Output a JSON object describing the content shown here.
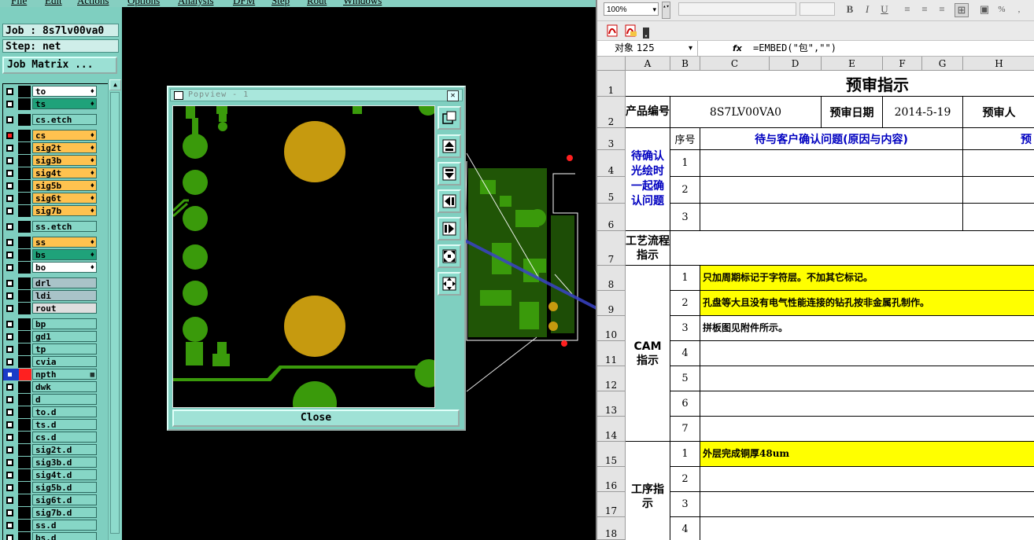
{
  "genesis": {
    "menu": [
      "File",
      "Edit",
      "Actions",
      "Options",
      "Analysis",
      "DFM",
      "Step",
      "Rout",
      "Windows"
    ],
    "job_label": "Job : 8s7lv00va0",
    "step_label": "Step: net",
    "job_matrix": "Job Matrix ...",
    "layers": [
      {
        "name": "to",
        "color": "#ffffff",
        "active": false,
        "mark": "♦"
      },
      {
        "name": "ts",
        "color": "#1fa27a",
        "active": false,
        "mark": "♦"
      },
      {
        "name": "cs.etch",
        "color": "#86d6c6",
        "active": false,
        "mark": ""
      },
      {
        "name": "cs",
        "color": "#ffc24f",
        "active": true,
        "mark": "♦"
      },
      {
        "name": "sig2t",
        "color": "#ffc24f",
        "active": false,
        "mark": "♦"
      },
      {
        "name": "sig3b",
        "color": "#ffc24f",
        "active": false,
        "mark": "♦"
      },
      {
        "name": "sig4t",
        "color": "#ffc24f",
        "active": false,
        "mark": "♦"
      },
      {
        "name": "sig5b",
        "color": "#ffc24f",
        "active": false,
        "mark": "♦"
      },
      {
        "name": "sig6t",
        "color": "#ffc24f",
        "active": false,
        "mark": "♦"
      },
      {
        "name": "sig7b",
        "color": "#ffc24f",
        "active": false,
        "mark": "♦"
      },
      {
        "name": "ss.etch",
        "color": "#86d6c6",
        "active": false,
        "mark": ""
      },
      {
        "name": "ss",
        "color": "#ffc24f",
        "active": false,
        "mark": "♦"
      },
      {
        "name": "bs",
        "color": "#1fa27a",
        "active": false,
        "mark": "♦"
      },
      {
        "name": "bo",
        "color": "#ffffff",
        "active": false,
        "mark": "♦"
      },
      {
        "name": "drl",
        "color": "#a9c3c8",
        "active": false,
        "mark": ""
      },
      {
        "name": "ldi",
        "color": "#a9c3c8",
        "active": false,
        "mark": ""
      },
      {
        "name": "rout",
        "color": "#dedede",
        "active": false,
        "mark": ""
      },
      {
        "name": "bp",
        "color": "#86d6c6",
        "active": false,
        "mark": ""
      },
      {
        "name": "gd1",
        "color": "#86d6c6",
        "active": false,
        "mark": ""
      },
      {
        "name": "tp",
        "color": "#86d6c6",
        "active": false,
        "mark": ""
      },
      {
        "name": "cvia",
        "color": "#86d6c6",
        "active": false,
        "mark": ""
      },
      {
        "name": "npth",
        "color": "#86d6c6",
        "active": false,
        "mark": "▦",
        "highlight": true
      },
      {
        "name": "dwk",
        "color": "#86d6c6",
        "active": false,
        "mark": ""
      },
      {
        "name": "d",
        "color": "#86d6c6",
        "active": false,
        "mark": ""
      },
      {
        "name": "to.d",
        "color": "#86d6c6",
        "active": false,
        "mark": ""
      },
      {
        "name": "ts.d",
        "color": "#86d6c6",
        "active": false,
        "mark": ""
      },
      {
        "name": "cs.d",
        "color": "#86d6c6",
        "active": false,
        "mark": ""
      },
      {
        "name": "sig2t.d",
        "color": "#86d6c6",
        "active": false,
        "mark": ""
      },
      {
        "name": "sig3b.d",
        "color": "#86d6c6",
        "active": false,
        "mark": ""
      },
      {
        "name": "sig4t.d",
        "color": "#86d6c6",
        "active": false,
        "mark": ""
      },
      {
        "name": "sig5b.d",
        "color": "#86d6c6",
        "active": false,
        "mark": ""
      },
      {
        "name": "sig6t.d",
        "color": "#86d6c6",
        "active": false,
        "mark": ""
      },
      {
        "name": "sig7b.d",
        "color": "#86d6c6",
        "active": false,
        "mark": ""
      },
      {
        "name": "ss.d",
        "color": "#86d6c6",
        "active": false,
        "mark": ""
      },
      {
        "name": "bs.d",
        "color": "#86d6c6",
        "active": false,
        "mark": ""
      }
    ],
    "popview": {
      "title": "Popview - 1",
      "close_label": "Close",
      "tools": [
        "zoom-fit-icon",
        "zoom-in-icon",
        "zoom-out-icon",
        "pan-left-icon",
        "pan-right-icon",
        "zoom-home-icon",
        "expand-icon"
      ]
    },
    "colors": {
      "trace_green": "#3a9a0b",
      "pad_gold": "#c69a0f",
      "annotation_arrow": "#3a43c8"
    }
  },
  "excel": {
    "zoom": "100%",
    "name_box": "对象 125",
    "fx": "fx",
    "formula": "=EMBED(\"包\",\"\")",
    "columns": [
      "A",
      "B",
      "C",
      "D",
      "E",
      "F",
      "G",
      "H"
    ],
    "rows": [
      "1",
      "2",
      "3",
      "4",
      "5",
      "6",
      "7",
      "8",
      "9",
      "10",
      "11",
      "12",
      "13",
      "14",
      "15",
      "16",
      "17",
      "18"
    ],
    "title": "预审指示",
    "product_no_label": "产品编号",
    "product_no": "8S7LV00VA0",
    "date_label": "预审日期",
    "date": "2014-5-19",
    "reviewer_label": "预审人",
    "seq_label": "序号",
    "confirm_col_label": "待与客户确认问题(原因与内容)",
    "confirm_col_right": "预",
    "confirm_group": "待确认光绘时一起确认问题",
    "confirm_seq": [
      "1",
      "2",
      "3"
    ],
    "process_label": "工艺流程指示",
    "cam_label": "CAM指示",
    "cam_seq": [
      "1",
      "2",
      "3",
      "4",
      "5",
      "6",
      "7"
    ],
    "cam_items": [
      "只加周期标记于字符层。不加其它标记。",
      "孔盘等大且没有电气性能连接的钻孔按非金属孔制作。",
      "拼板图见附件所示。",
      "",
      "",
      "",
      ""
    ],
    "proc_label": "工序指示",
    "proc_seq": [
      "1",
      "2",
      "3",
      "4"
    ],
    "proc_items": [
      "外层完成铜厚48um",
      "",
      "",
      ""
    ]
  }
}
